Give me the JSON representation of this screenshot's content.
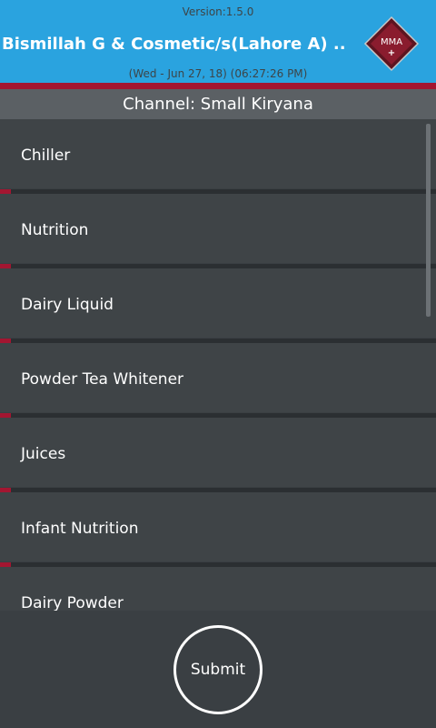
{
  "header": {
    "version": "Version:1.5.0",
    "store_name": "Bismillah G & Cosmetic/s(Lahore A) ..",
    "datetime": "(Wed - Jun 27, 18) (06:27:26 PM)",
    "logo_text": "MMA",
    "logo_plus": "+"
  },
  "channel": {
    "label": "Channel: Small Kiryana"
  },
  "categories": [
    {
      "label": "Chiller"
    },
    {
      "label": "Nutrition"
    },
    {
      "label": "Dairy Liquid"
    },
    {
      "label": "Powder Tea Whitener"
    },
    {
      "label": "Juices"
    },
    {
      "label": "Infant Nutrition"
    },
    {
      "label": "Dairy Powder"
    }
  ],
  "submit": {
    "label": "Submit"
  },
  "colors": {
    "header_bg": "#2aa3df",
    "accent": "#a31631",
    "background": "#3a3f43",
    "item_bg": "#3f4447",
    "channel_bg": "#5b6064"
  }
}
